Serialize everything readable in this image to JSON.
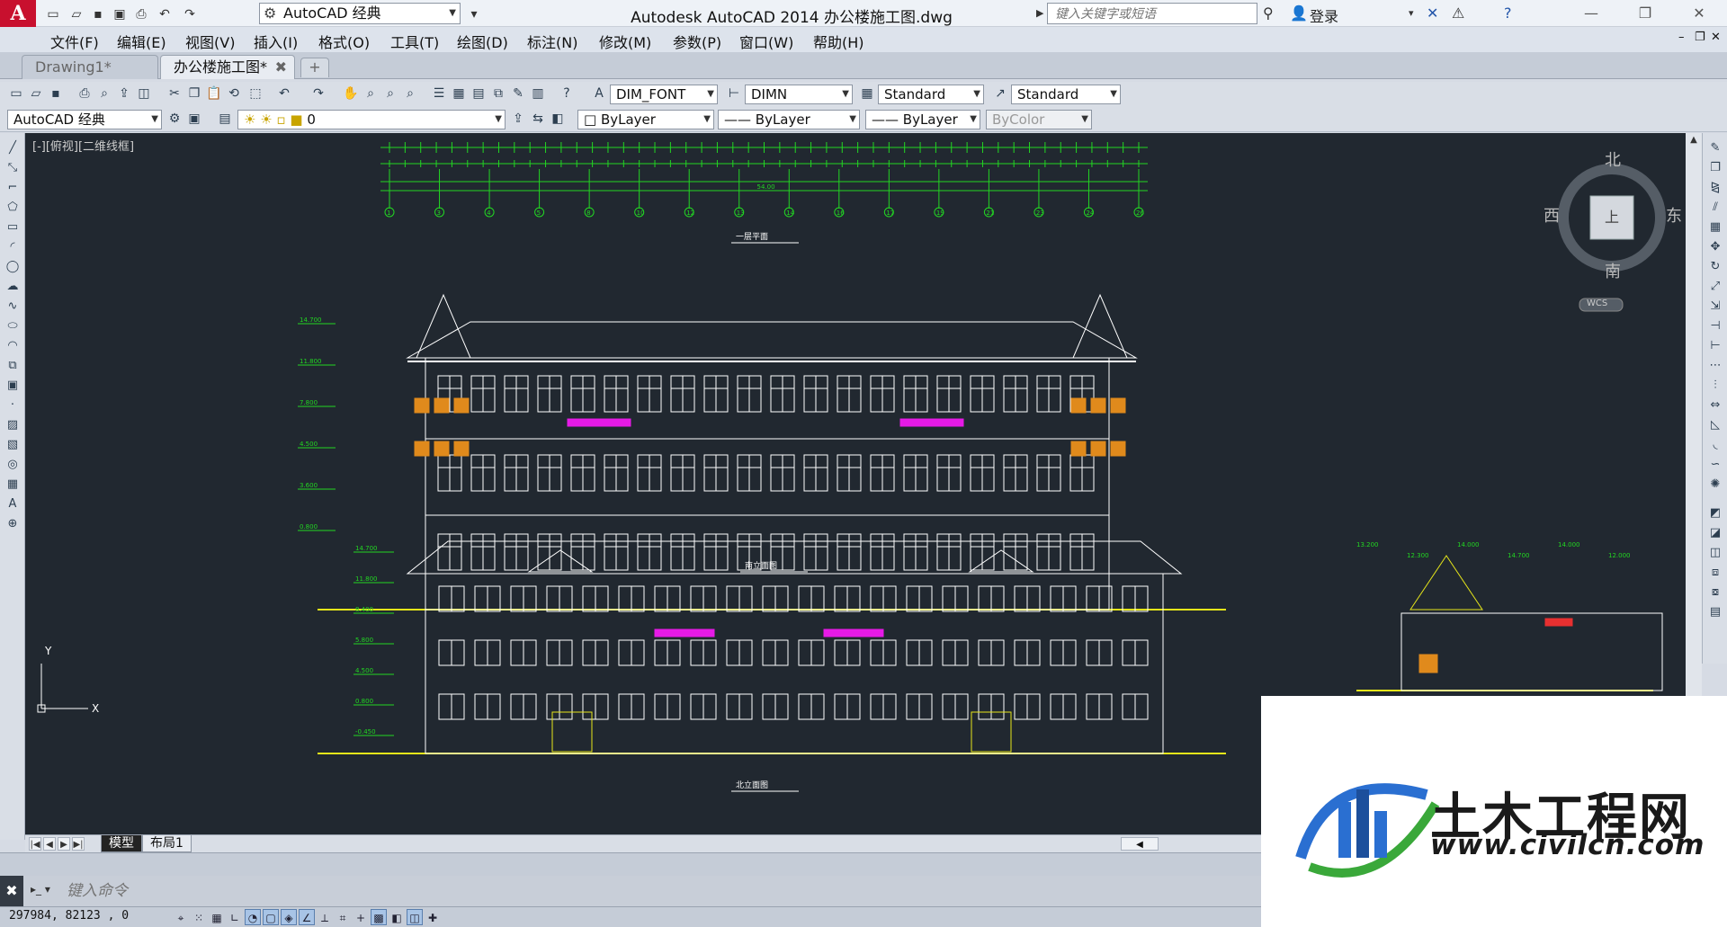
{
  "titlebar": {
    "app_logo": "A",
    "workspace": "AutoCAD 经典",
    "window_title": "Autodesk AutoCAD 2014    办公楼施工图.dwg",
    "search_placeholder": "键入关键字或短语",
    "login": "登录"
  },
  "menu": [
    "文件(F)",
    "编辑(E)",
    "视图(V)",
    "插入(I)",
    "格式(O)",
    "工具(T)",
    "绘图(D)",
    "标注(N)",
    "修改(M)",
    "参数(P)",
    "窗口(W)",
    "帮助(H)"
  ],
  "doc_tabs": {
    "drawing1": "Drawing1*",
    "office": "办公楼施工图*"
  },
  "toolbar": {
    "text_style": "DIM_FONT",
    "dim_style": "DIMN",
    "table_style": "Standard",
    "mleader_style": "Standard",
    "workspace2": "AutoCAD 经典",
    "layer": "0",
    "color": "ByLayer",
    "linetype": "ByLayer",
    "lineweight": "ByLayer",
    "plotstyle": "ByColor"
  },
  "canvas": {
    "viewport_label": "[-][俯视][二维线框]",
    "ucs_x": "X",
    "ucs_y": "Y",
    "background": "#212830"
  },
  "viewcube": {
    "north": "北",
    "south": "南",
    "east": "东",
    "west": "西",
    "top": "上",
    "wcs": "WCS"
  },
  "drawing": {
    "plan_title": "一层平面",
    "south_title": "南立面图",
    "north_title": "北立面图",
    "plan_total": "54.00",
    "grid_labels": [
      "1",
      "3",
      "4",
      "5",
      "8",
      "10",
      "12",
      "13",
      "14",
      "16",
      "17",
      "19",
      "21",
      "23",
      "24",
      "26"
    ],
    "elev_labels_south": [
      "14.700",
      "11.800",
      "7.800",
      "4.500",
      "3.600",
      "0.800"
    ],
    "elev_labels_north": [
      "14.700",
      "11.800",
      "8.400",
      "5.800",
      "4.500",
      "0.800",
      "-0.450"
    ],
    "annotations": [
      "13.200",
      "12.300",
      "14.000",
      "14.700",
      "14.000",
      "12.000"
    ],
    "colors": {
      "white": "#ffffff",
      "green": "#22d622",
      "yellow": "#e6e61a",
      "magenta": "#e61ae6",
      "orange": "#e08a1c",
      "red": "#e83030"
    }
  },
  "layout_tabs": {
    "model": "模型",
    "layout1": "布局1"
  },
  "command": {
    "placeholder": "键入命令"
  },
  "status": {
    "coords": "297984, 82123 , 0"
  },
  "watermark": {
    "name": "土木工程网",
    "url": "www.civilcn.com"
  }
}
